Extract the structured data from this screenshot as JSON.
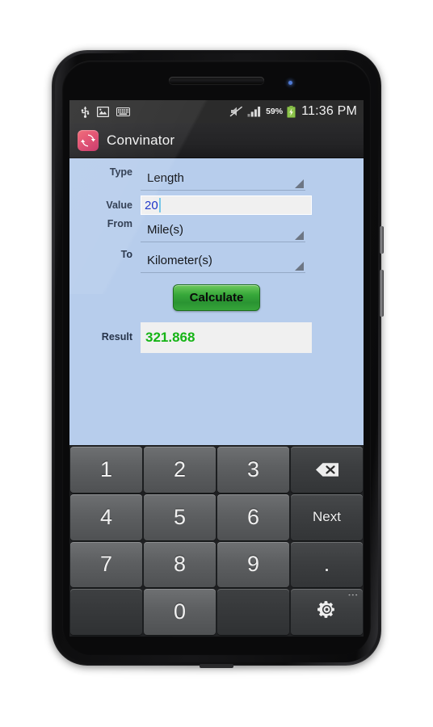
{
  "device": {
    "earpiece": "earpiece-speaker",
    "led": "notification-led",
    "bottom_speaker": "bottom-speaker-grille"
  },
  "statusbar": {
    "left_icons": [
      {
        "name": "usb-icon",
        "label": "USB connected"
      },
      {
        "name": "image-icon",
        "label": "Screenshot captured"
      },
      {
        "name": "keyboard-icon",
        "label": "Keyboard active"
      }
    ],
    "right_icons": [
      {
        "name": "volume-muted-icon",
        "label": "Silent mode"
      },
      {
        "name": "signal-bars-icon",
        "label": "Signal strength"
      }
    ],
    "battery_percent": "59%",
    "battery_state": "charging",
    "time": "11:36 PM",
    "background_color": "#2b2b2b"
  },
  "titlebar": {
    "app_icon": "convinator-refresh-icon",
    "app_name": "Convinator",
    "icon_color": "#d8396a"
  },
  "form": {
    "background_color": "#b7cdec",
    "fields": [
      {
        "label": "Type",
        "value": "Length",
        "kind": "spinner",
        "name": "type-spinner"
      },
      {
        "label": "Value",
        "value": "20",
        "kind": "input",
        "name": "value-input"
      },
      {
        "label": "From",
        "value": "Mile(s)",
        "kind": "spinner",
        "name": "from-spinner"
      },
      {
        "label": "To",
        "value": "Kilometer(s)",
        "kind": "spinner",
        "name": "to-spinner"
      }
    ],
    "calculate_label": "Calculate",
    "calculate_color": "#35a338",
    "result_label": "Result",
    "result_value": "321.868",
    "result_color": "#16b416",
    "value_text_color": "#1932c8"
  },
  "keyboard": {
    "background_color": "#1f2022",
    "rows": [
      [
        {
          "label": "1",
          "name": "key-1",
          "style": "num"
        },
        {
          "label": "2",
          "name": "key-2",
          "style": "num"
        },
        {
          "label": "3",
          "name": "key-3",
          "style": "num"
        },
        {
          "label": "",
          "name": "key-backspace",
          "style": "backspace"
        }
      ],
      [
        {
          "label": "4",
          "name": "key-4",
          "style": "num"
        },
        {
          "label": "5",
          "name": "key-5",
          "style": "num"
        },
        {
          "label": "6",
          "name": "key-6",
          "style": "num"
        },
        {
          "label": "Next",
          "name": "key-next",
          "style": "func"
        }
      ],
      [
        {
          "label": "7",
          "name": "key-7",
          "style": "num"
        },
        {
          "label": "8",
          "name": "key-8",
          "style": "num"
        },
        {
          "label": "9",
          "name": "key-9",
          "style": "num"
        },
        {
          "label": ".",
          "name": "key-period",
          "style": "dot"
        }
      ],
      [
        {
          "label": "",
          "name": "key-blank-left",
          "style": "blank"
        },
        {
          "label": "0",
          "name": "key-0",
          "style": "num"
        },
        {
          "label": "",
          "name": "key-blank-right",
          "style": "blank"
        },
        {
          "label": "",
          "name": "key-settings",
          "style": "gear"
        }
      ]
    ]
  }
}
